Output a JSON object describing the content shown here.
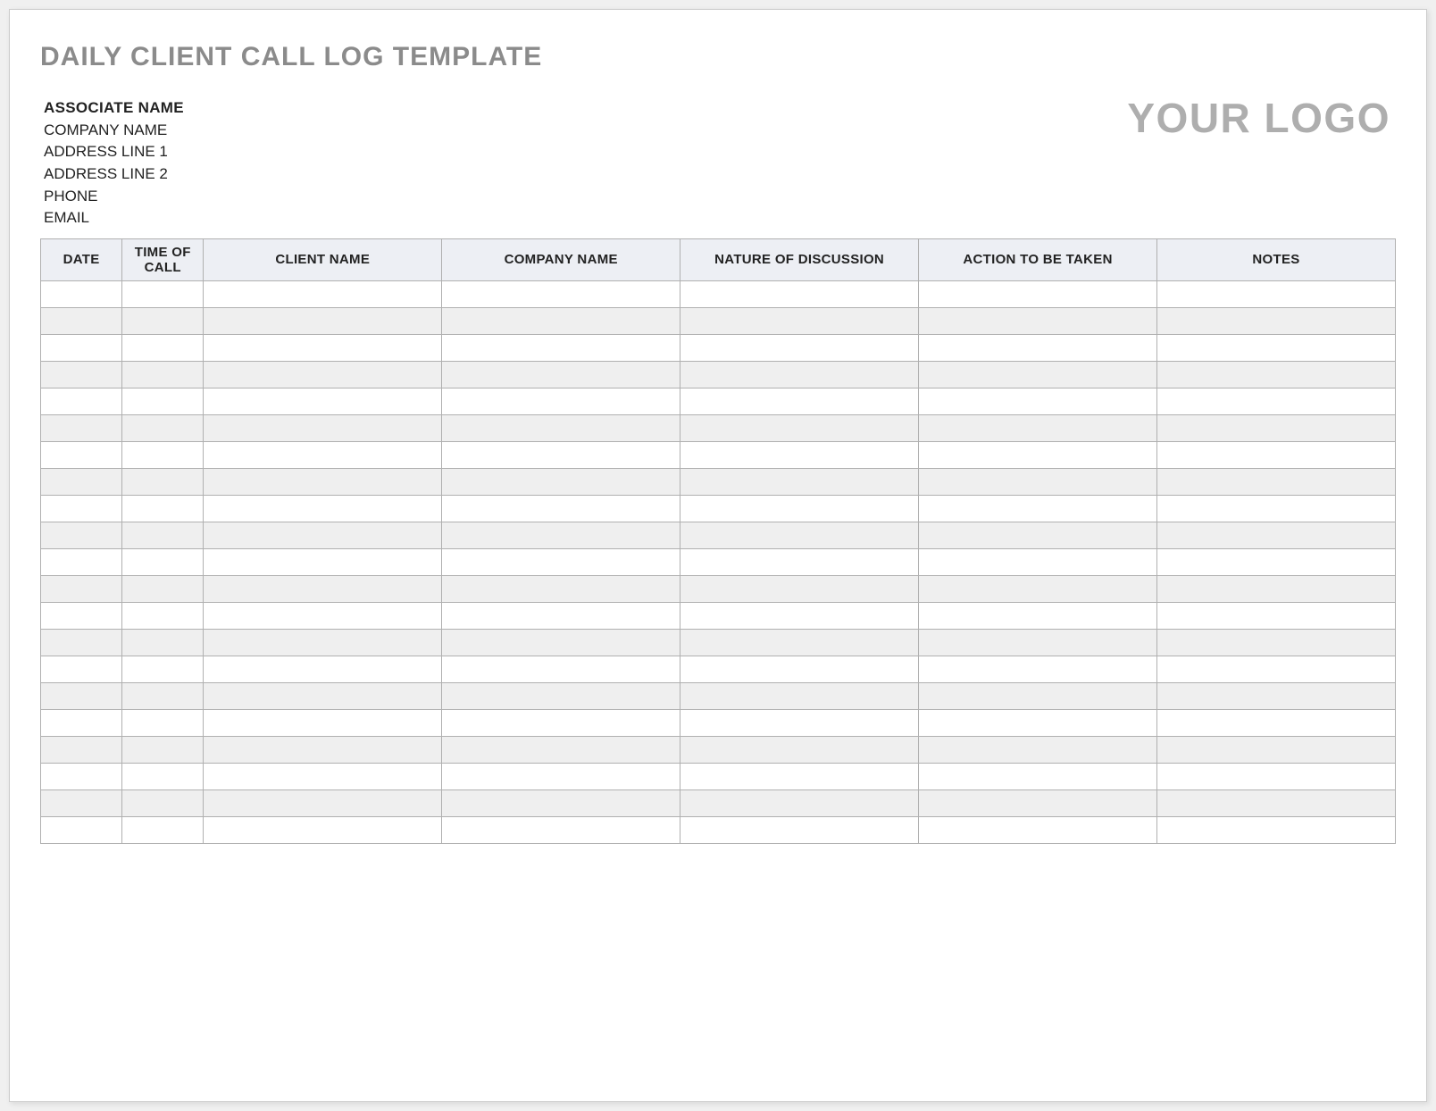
{
  "title": "DAILY CLIENT CALL LOG TEMPLATE",
  "associate": {
    "name": "ASSOCIATE NAME",
    "company": "COMPANY NAME",
    "address1": "ADDRESS LINE 1",
    "address2": "ADDRESS LINE 2",
    "phone": "PHONE",
    "email": "EMAIL"
  },
  "logo_text": "YOUR LOGO",
  "table": {
    "headers": {
      "date": "DATE",
      "time": "TIME OF CALL",
      "client": "CLIENT NAME",
      "company": "COMPANY NAME",
      "nature": "NATURE OF DISCUSSION",
      "action": "ACTION TO BE TAKEN",
      "notes": "NOTES"
    },
    "row_count": 21
  }
}
